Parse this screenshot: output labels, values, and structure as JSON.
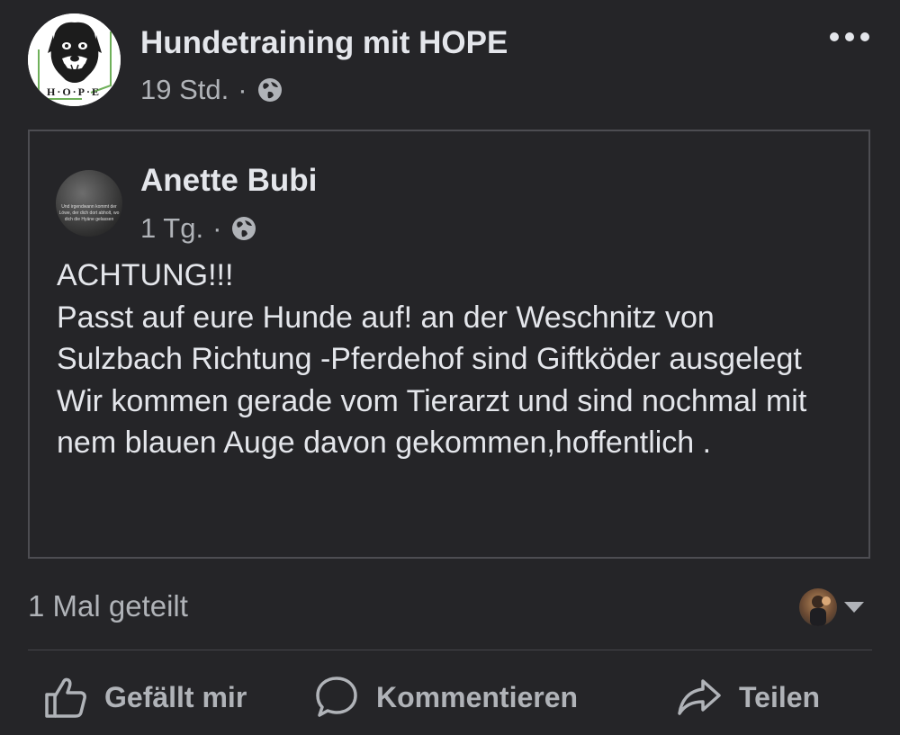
{
  "header": {
    "page_name": "Hundetraining mit HOPE",
    "time": "19 Std.",
    "separator": "·",
    "privacy_icon": "globe-icon",
    "avatar_logo_text": "HOPE",
    "more_icon": "more-dots-icon"
  },
  "shared_post": {
    "author_name": "Anette Bubi",
    "time": "1 Tg.",
    "separator": "·",
    "privacy_icon": "globe-icon",
    "avatar_text": "Und irgendwann kommt der Löwe, der dich dort abholt, wo dich die Hyäne gelassen",
    "text": "ACHTUNG!!!\nPasst auf eure Hunde auf! an der Weschnitz von Sulzbach Richtung -Pferdehof sind Giftköder ausgelegt\nWir kommen gerade vom Tierarzt und sind nochmal mit nem blauen Auge davon gekommen,hoffentlich ."
  },
  "stats": {
    "share_count": "1 Mal geteilt"
  },
  "actions": {
    "like_label": "Gefällt mir",
    "like_icon": "thumbs-up-icon",
    "comment_label": "Kommentieren",
    "comment_icon": "speech-bubble-icon",
    "share_label": "Teilen",
    "share_icon": "share-arrow-icon"
  },
  "colors": {
    "background": "#252528",
    "primary_text": "#e4e6eb",
    "secondary_text": "#b0b3b8",
    "border": "#4d4d52"
  }
}
